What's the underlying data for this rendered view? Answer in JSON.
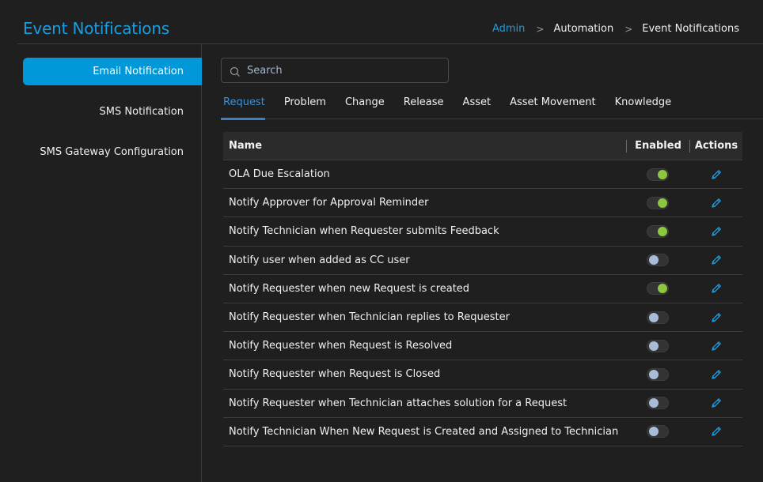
{
  "header": {
    "title": "Event Notifications",
    "breadcrumb": [
      {
        "label": "Admin",
        "link": true
      },
      {
        "label": "Automation",
        "link": false
      },
      {
        "label": "Event Notifications",
        "link": false
      }
    ],
    "breadcrumb_separator": ">"
  },
  "sidebar": {
    "items": [
      {
        "label": "Email Notification",
        "active": true
      },
      {
        "label": "SMS Notification",
        "active": false
      },
      {
        "label": "SMS Gateway Configuration",
        "active": false
      }
    ]
  },
  "search": {
    "placeholder": "Search",
    "value": "",
    "icon": "search-icon"
  },
  "tabs": [
    {
      "label": "Request",
      "active": true
    },
    {
      "label": "Problem",
      "active": false
    },
    {
      "label": "Change",
      "active": false
    },
    {
      "label": "Release",
      "active": false
    },
    {
      "label": "Asset",
      "active": false
    },
    {
      "label": "Asset Movement",
      "active": false
    },
    {
      "label": "Knowledge",
      "active": false
    }
  ],
  "table": {
    "columns": {
      "name": "Name",
      "enabled": "Enabled",
      "actions": "Actions"
    },
    "rows": [
      {
        "name": "OLA Due Escalation",
        "enabled": true
      },
      {
        "name": "Notify Approver for Approval Reminder",
        "enabled": true
      },
      {
        "name": "Notify Technician when Requester submits Feedback",
        "enabled": true
      },
      {
        "name": "Notify user when added as CC user",
        "enabled": false
      },
      {
        "name": "Notify Requester when new Request is created",
        "enabled": true
      },
      {
        "name": "Notify Requester when Technician replies to Requester",
        "enabled": false
      },
      {
        "name": "Notify Requester when Request is Resolved",
        "enabled": false
      },
      {
        "name": "Notify Requester when Request is Closed",
        "enabled": false
      },
      {
        "name": "Notify Requester when Technician attaches solution for a Request",
        "enabled": false
      },
      {
        "name": "Notify Technician When New Request is Created and Assigned to Technician",
        "enabled": false
      }
    ],
    "action_icon": "pencil-edit-icon"
  },
  "colors": {
    "accent": "#1b9ee0",
    "sidebar_active": "#0098d9",
    "toggle_on": "#8dc63f",
    "toggle_off": "#a8bcd8",
    "background": "#1f1f1f"
  }
}
